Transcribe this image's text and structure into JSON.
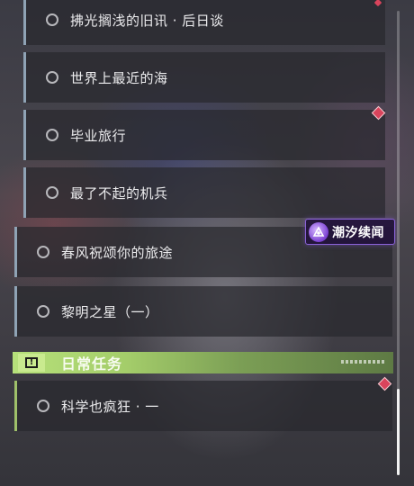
{
  "quests": {
    "items": [
      {
        "label": "拂光搁浅的旧讯 · 后日谈"
      },
      {
        "label": "世界上最近的海"
      },
      {
        "label": "毕业旅行"
      },
      {
        "label": "最了不起的机兵"
      },
      {
        "label": "春风祝颂你的旅途"
      },
      {
        "label": "黎明之星（一）"
      }
    ]
  },
  "event_badge": {
    "label": "潮汐续闻"
  },
  "daily_section": {
    "title": "日常任务",
    "icon_glyph": "!",
    "items": [
      {
        "label": "科学也疯狂 · 一"
      }
    ]
  },
  "colors": {
    "sub_border": "#8fa3b5",
    "daily_accent": "#a4cd6a",
    "marker": "#d9445c",
    "badge_accent": "#8a62d8"
  }
}
